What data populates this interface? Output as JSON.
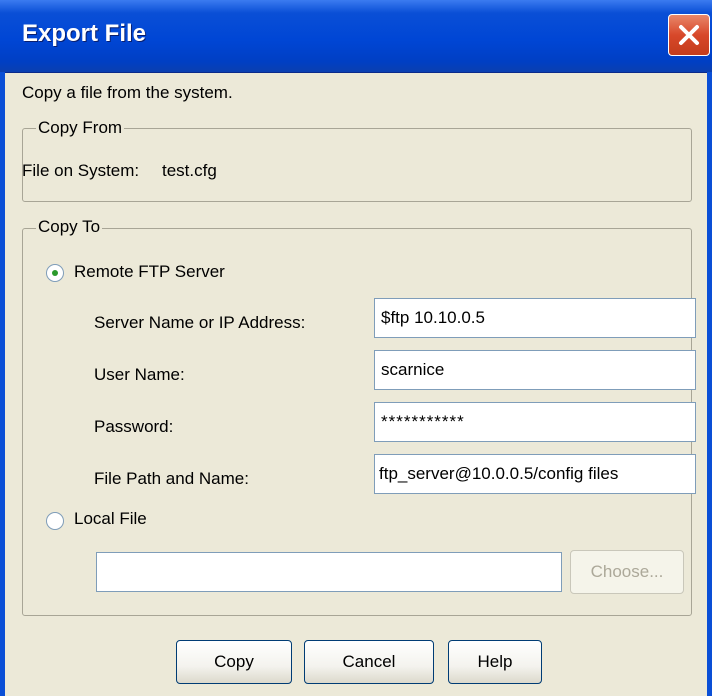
{
  "window": {
    "title": "Export File"
  },
  "intro": "Copy a file from the system.",
  "copy_from": {
    "legend": "Copy From",
    "file_label": "File on System:",
    "file_value": "test.cfg"
  },
  "copy_to": {
    "legend": "Copy To",
    "remote_option": {
      "label": "Remote FTP Server",
      "selected": true
    },
    "fields": {
      "server": {
        "label": "Server Name or IP Address:",
        "value": "$ftp 10.10.0.5"
      },
      "user": {
        "label": "User Name:",
        "value": "scarnice"
      },
      "password": {
        "label": "Password:",
        "value": "***********"
      },
      "path": {
        "label": "File Path and Name:",
        "value": "ftp_server@10.0.0.5/config files"
      }
    },
    "local_option": {
      "label": "Local File",
      "selected": false
    },
    "local_path": {
      "value": ""
    },
    "choose_label": "Choose..."
  },
  "buttons": {
    "copy": "Copy",
    "cancel": "Cancel",
    "help": "Help"
  },
  "icons": {
    "close": "close-icon"
  },
  "colors": {
    "title_bar": "#0046d5",
    "close_button": "#d8482a",
    "dialog_bg": "#ece9d8"
  }
}
